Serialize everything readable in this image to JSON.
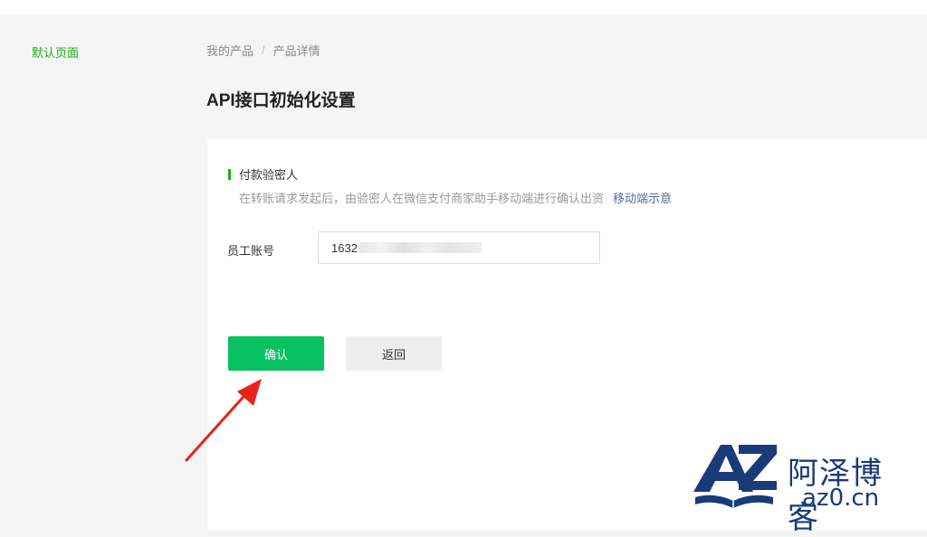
{
  "sidebar": {
    "default_page": "默认页面"
  },
  "breadcrumb": {
    "items": [
      "我的产品",
      "产品详情"
    ],
    "separator": "/"
  },
  "page": {
    "title": "API接口初始化设置"
  },
  "section": {
    "title": "付款验密人",
    "description": "在转账请求发起后，由验密人在微信支付商家助手移动端进行确认出资",
    "link": "移动端示意"
  },
  "form": {
    "employee_account_label": "员工账号",
    "employee_account_value": "1632"
  },
  "buttons": {
    "confirm": "确认",
    "back": "返回"
  },
  "watermark": {
    "logo_text": "AZ",
    "chinese": "阿泽博客",
    "domain": "az0.cn"
  },
  "colors": {
    "brand_green": "#07c160",
    "link_blue": "#576b95",
    "arrow_red": "#e8221b",
    "watermark_blue": "#1a3a7a"
  }
}
